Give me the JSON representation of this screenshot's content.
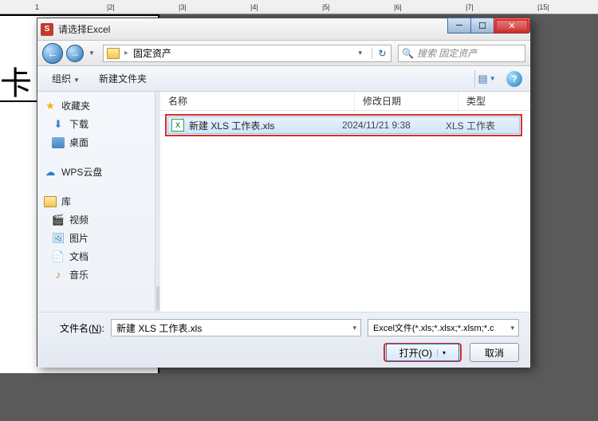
{
  "ruler_marks": [
    {
      "pos": 0,
      "label": ""
    },
    {
      "pos": 44,
      "label": "1"
    },
    {
      "pos": 134,
      "label": "|2|"
    },
    {
      "pos": 224,
      "label": "|3|"
    },
    {
      "pos": 314,
      "label": "|4|"
    },
    {
      "pos": 404,
      "label": "|5|"
    },
    {
      "pos": 494,
      "label": "|6|"
    },
    {
      "pos": 584,
      "label": "|7|"
    },
    {
      "pos": 674,
      "label": "|15|"
    }
  ],
  "bg_card": "卡",
  "dialog": {
    "title": "请选择Excel",
    "breadcrumb": {
      "folder": "固定资产"
    },
    "search_placeholder": "搜索 固定资产",
    "toolbar": {
      "organize": "组织",
      "newfolder": "新建文件夹"
    },
    "sidebar": {
      "fav": "收藏夹",
      "downloads": "下载",
      "desktop": "桌面",
      "wps": "WPS云盘",
      "lib": "库",
      "videos": "视频",
      "pictures": "图片",
      "docs": "文档",
      "music": "音乐"
    },
    "columns": {
      "name": "名称",
      "date": "修改日期",
      "type": "类型"
    },
    "file": {
      "name": "新建 XLS 工作表.xls",
      "date": "2024/11/21 9:38",
      "type": "XLS 工作表"
    },
    "filename_label_pre": "文件名(",
    "filename_label_u": "N",
    "filename_label_post": "):",
    "filename_value": "新建 XLS 工作表.xls",
    "filter": "Excel文件(*.xls;*.xlsx;*.xlsm;*.c",
    "open_label": "打开(O)",
    "cancel_label": "取消"
  }
}
